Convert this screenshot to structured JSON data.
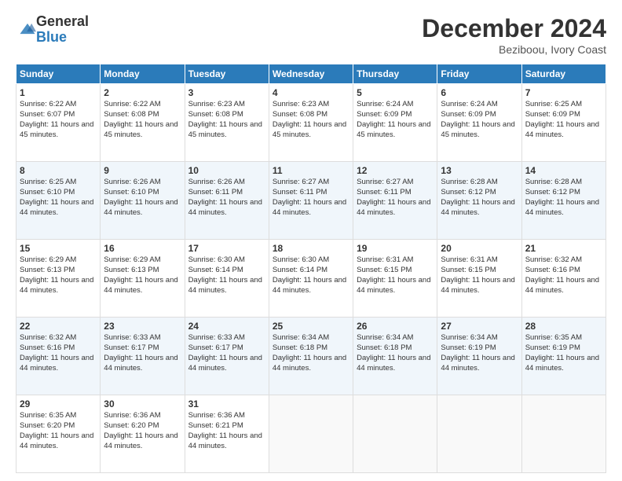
{
  "logo": {
    "general": "General",
    "blue": "Blue"
  },
  "header": {
    "month": "December 2024",
    "location": "Beziboou, Ivory Coast"
  },
  "weekdays": [
    "Sunday",
    "Monday",
    "Tuesday",
    "Wednesday",
    "Thursday",
    "Friday",
    "Saturday"
  ],
  "weeks": [
    [
      {
        "day": "1",
        "sunrise": "6:22 AM",
        "sunset": "6:07 PM",
        "daylight": "11 hours and 45 minutes."
      },
      {
        "day": "2",
        "sunrise": "6:22 AM",
        "sunset": "6:08 PM",
        "daylight": "11 hours and 45 minutes."
      },
      {
        "day": "3",
        "sunrise": "6:23 AM",
        "sunset": "6:08 PM",
        "daylight": "11 hours and 45 minutes."
      },
      {
        "day": "4",
        "sunrise": "6:23 AM",
        "sunset": "6:08 PM",
        "daylight": "11 hours and 45 minutes."
      },
      {
        "day": "5",
        "sunrise": "6:24 AM",
        "sunset": "6:09 PM",
        "daylight": "11 hours and 45 minutes."
      },
      {
        "day": "6",
        "sunrise": "6:24 AM",
        "sunset": "6:09 PM",
        "daylight": "11 hours and 45 minutes."
      },
      {
        "day": "7",
        "sunrise": "6:25 AM",
        "sunset": "6:09 PM",
        "daylight": "11 hours and 44 minutes."
      }
    ],
    [
      {
        "day": "8",
        "sunrise": "6:25 AM",
        "sunset": "6:10 PM",
        "daylight": "11 hours and 44 minutes."
      },
      {
        "day": "9",
        "sunrise": "6:26 AM",
        "sunset": "6:10 PM",
        "daylight": "11 hours and 44 minutes."
      },
      {
        "day": "10",
        "sunrise": "6:26 AM",
        "sunset": "6:11 PM",
        "daylight": "11 hours and 44 minutes."
      },
      {
        "day": "11",
        "sunrise": "6:27 AM",
        "sunset": "6:11 PM",
        "daylight": "11 hours and 44 minutes."
      },
      {
        "day": "12",
        "sunrise": "6:27 AM",
        "sunset": "6:11 PM",
        "daylight": "11 hours and 44 minutes."
      },
      {
        "day": "13",
        "sunrise": "6:28 AM",
        "sunset": "6:12 PM",
        "daylight": "11 hours and 44 minutes."
      },
      {
        "day": "14",
        "sunrise": "6:28 AM",
        "sunset": "6:12 PM",
        "daylight": "11 hours and 44 minutes."
      }
    ],
    [
      {
        "day": "15",
        "sunrise": "6:29 AM",
        "sunset": "6:13 PM",
        "daylight": "11 hours and 44 minutes."
      },
      {
        "day": "16",
        "sunrise": "6:29 AM",
        "sunset": "6:13 PM",
        "daylight": "11 hours and 44 minutes."
      },
      {
        "day": "17",
        "sunrise": "6:30 AM",
        "sunset": "6:14 PM",
        "daylight": "11 hours and 44 minutes."
      },
      {
        "day": "18",
        "sunrise": "6:30 AM",
        "sunset": "6:14 PM",
        "daylight": "11 hours and 44 minutes."
      },
      {
        "day": "19",
        "sunrise": "6:31 AM",
        "sunset": "6:15 PM",
        "daylight": "11 hours and 44 minutes."
      },
      {
        "day": "20",
        "sunrise": "6:31 AM",
        "sunset": "6:15 PM",
        "daylight": "11 hours and 44 minutes."
      },
      {
        "day": "21",
        "sunrise": "6:32 AM",
        "sunset": "6:16 PM",
        "daylight": "11 hours and 44 minutes."
      }
    ],
    [
      {
        "day": "22",
        "sunrise": "6:32 AM",
        "sunset": "6:16 PM",
        "daylight": "11 hours and 44 minutes."
      },
      {
        "day": "23",
        "sunrise": "6:33 AM",
        "sunset": "6:17 PM",
        "daylight": "11 hours and 44 minutes."
      },
      {
        "day": "24",
        "sunrise": "6:33 AM",
        "sunset": "6:17 PM",
        "daylight": "11 hours and 44 minutes."
      },
      {
        "day": "25",
        "sunrise": "6:34 AM",
        "sunset": "6:18 PM",
        "daylight": "11 hours and 44 minutes."
      },
      {
        "day": "26",
        "sunrise": "6:34 AM",
        "sunset": "6:18 PM",
        "daylight": "11 hours and 44 minutes."
      },
      {
        "day": "27",
        "sunrise": "6:34 AM",
        "sunset": "6:19 PM",
        "daylight": "11 hours and 44 minutes."
      },
      {
        "day": "28",
        "sunrise": "6:35 AM",
        "sunset": "6:19 PM",
        "daylight": "11 hours and 44 minutes."
      }
    ],
    [
      {
        "day": "29",
        "sunrise": "6:35 AM",
        "sunset": "6:20 PM",
        "daylight": "11 hours and 44 minutes."
      },
      {
        "day": "30",
        "sunrise": "6:36 AM",
        "sunset": "6:20 PM",
        "daylight": "11 hours and 44 minutes."
      },
      {
        "day": "31",
        "sunrise": "6:36 AM",
        "sunset": "6:21 PM",
        "daylight": "11 hours and 44 minutes."
      },
      null,
      null,
      null,
      null
    ]
  ]
}
